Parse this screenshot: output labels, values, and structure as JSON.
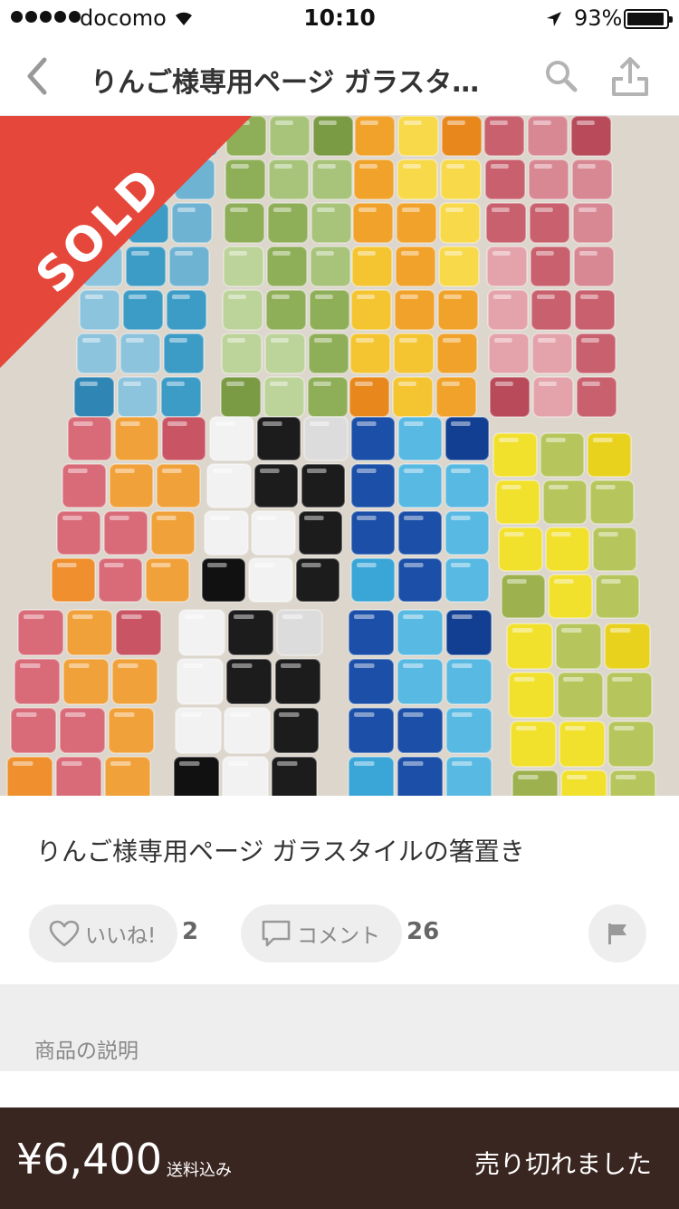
{
  "status_bar": {
    "carrier": "docomo",
    "time": "10:10",
    "battery_percent": "93%",
    "battery_level": 0.93,
    "icons": [
      "signal-dots-icon",
      "wifi-icon",
      "location-arrow-icon",
      "battery-icon"
    ]
  },
  "nav": {
    "title": "りんご様専用ページ ガラスタイルの箸置き",
    "icons": [
      "chevron-left-icon",
      "search-icon",
      "share-icon"
    ]
  },
  "product": {
    "sold_badge": "SOLD",
    "title": "りんご様専用ページ ガラスタイルの箸置き",
    "likes_label": "いいね!",
    "likes_count": "2",
    "comments_label": "コメント",
    "comments_count": "26",
    "icons": [
      "heart-icon",
      "comment-icon",
      "flag-icon"
    ]
  },
  "description": {
    "heading": "商品の説明"
  },
  "footer": {
    "price": "¥6,400",
    "shipping_note": "送料込み",
    "status": "売り切れました"
  },
  "colors": {
    "sold_ribbon": "#e5473b",
    "bottom_bar": "#3a2620",
    "pill_bg": "#eeeeee",
    "section_bg": "#eeeeee"
  }
}
